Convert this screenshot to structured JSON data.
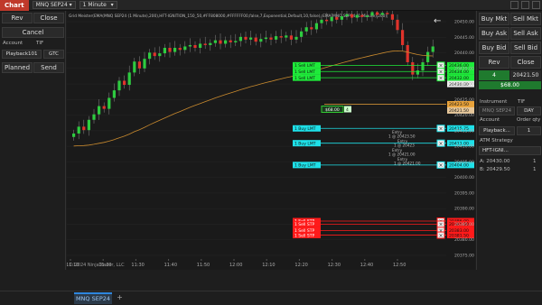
{
  "topbar": {
    "chart_tab": "Chart",
    "instrument": "MNQ SEP24",
    "timeframe": "1 Minute"
  },
  "chart": {
    "header_text": "Grid Meister(EMA(MNQ SEP24 (1 Minute),200),HFT-IGNITION_150_50,#FF808000,#FFFFFF00,false,7,Exponential,Default,10,false), EMA(MNQ SEP24 (1 Minute),200)",
    "copyright": "© 2024 NinjaTrader, LLC",
    "price_ticks": [
      "20450.00",
      "20445.00",
      "20440.00",
      "20435.00",
      "20430.00",
      "20425.00",
      "20420.00",
      "20415.00",
      "20410.00",
      "20405.00",
      "20400.00",
      "20395.00",
      "20390.00",
      "20385.00",
      "20380.00",
      "20375.00"
    ],
    "time_ticks": [
      "11:10",
      "11:20",
      "11:30",
      "11:40",
      "11:50",
      "12:00",
      "12:10",
      "12:20",
      "12:30",
      "12:40",
      "12:50"
    ],
    "orders_sell_limit": [
      {
        "label": "1  Sell LMT",
        "price": "20436.00"
      },
      {
        "label": "1  Sell LMT",
        "price": "20434.00"
      },
      {
        "label": "1  Sell LMT",
        "price": "20432.00"
      }
    ],
    "price_tag_sell": "20430.00",
    "position_tag": "20423.50",
    "current_price_tag": "20421.50",
    "pnl_box": "$68.00",
    "pnl_qty": "4",
    "orders_buy_limit": [
      {
        "label": "1  Buy LMT",
        "price": "20415.75"
      },
      {
        "label": "1  Buy LMT",
        "price": "20411.00"
      },
      {
        "label": "1  Buy LMT",
        "price": "20404.00"
      }
    ],
    "orders_sell_stop": [
      {
        "label": "1  Sell STP",
        "price": "20386.00"
      },
      {
        "label": "1  Sell STP",
        "price": "20385.00"
      },
      {
        "label": "1  Sell STP",
        "price": "20383.00"
      },
      {
        "label": "1  Sell STP",
        "price": "20381.50"
      }
    ],
    "entries": [
      {
        "label": "Entry",
        "detail": "1 @ 20423.50"
      },
      {
        "label": "Entry",
        "detail": "1 @ 20423"
      },
      {
        "label": "Entry",
        "detail": "1 @ 20421.00"
      },
      {
        "label": "Entry",
        "detail": "1 @ 20421.00"
      }
    ]
  },
  "left_panel": {
    "rev": "Rev",
    "close": "Close",
    "cancel": "Cancel",
    "account_label": "Account",
    "tif_label": "TIF",
    "account_value": "Playback101",
    "tif_value": "GTC",
    "planned": "Planned",
    "send": "Send"
  },
  "right_panel": {
    "buy_mkt": "Buy Mkt",
    "sell_mkt": "Sell Mkt",
    "buy_ask": "Buy Ask",
    "sell_ask": "Sell Ask",
    "buy_bid": "Buy Bid",
    "sell_bid": "Sell Bid",
    "rev": "Rev",
    "close": "Close",
    "position_qty": "4",
    "position_price": "20421.50",
    "position_pnl": "$68.00",
    "instrument_label": "Instrument",
    "tif_label": "TIF",
    "instrument_value": "MNQ SEP24",
    "tif_value": "DAY",
    "account_label": "Account",
    "order_qty_label": "Order qty",
    "account_value": "Playback...",
    "order_qty_value": "1",
    "atm_label": "ATM Strategy",
    "atm_value": "HFT-IGNI...",
    "a_line": "A: 20430.00",
    "a_qty": "1",
    "b_line": "B: 20429.50",
    "b_qty": "1"
  },
  "bottom": {
    "tab": "MNQ SEP24",
    "plus": "+"
  },
  "colors": {
    "chart_tab": "#c0392b",
    "up_candle": "#2ecc40",
    "down_candle": "#e0332b",
    "sell_limit": "#1eea3a",
    "buy_limit": "#1ee0e8",
    "sell_stop": "#ff1a1a",
    "ema": "#c98a2e",
    "position": "#e8a23a"
  }
}
